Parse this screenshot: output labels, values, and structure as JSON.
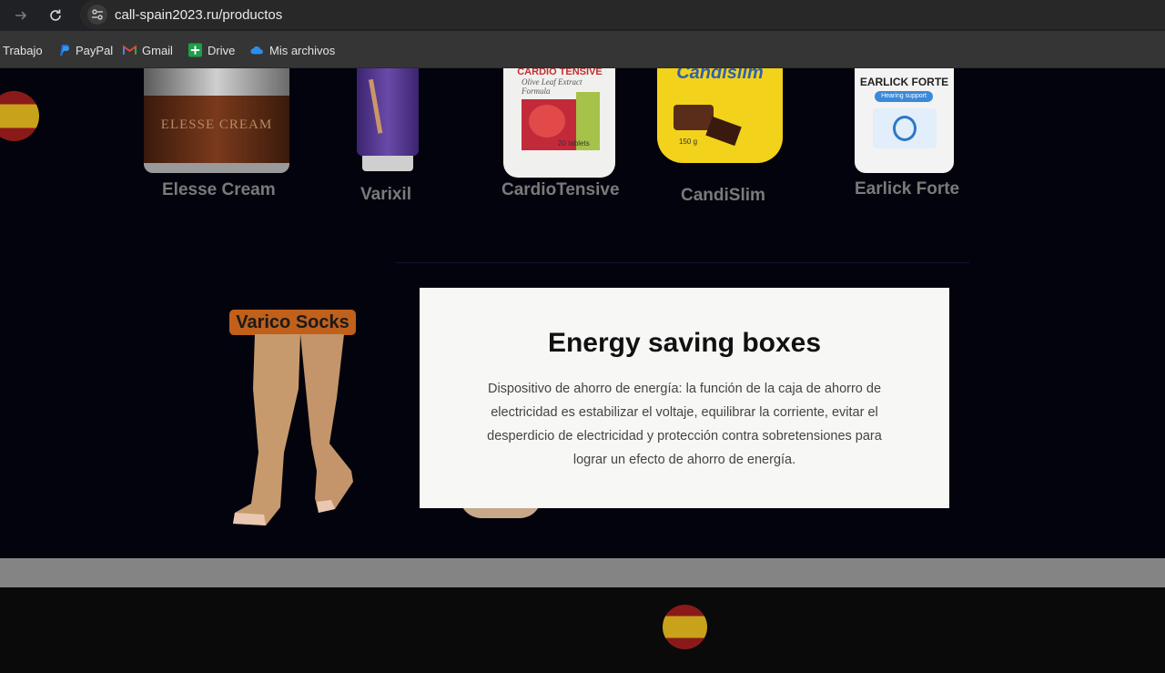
{
  "browser": {
    "url": "call-spain2023.ru/productos",
    "nav_icons": [
      "forward-arrow-icon",
      "reload-icon"
    ],
    "bookmarks": [
      {
        "label": "Trabajo",
        "icon": "folder-icon"
      },
      {
        "label": "PayPal",
        "icon": "paypal-icon"
      },
      {
        "label": "Gmail",
        "icon": "gmail-icon"
      },
      {
        "label": "Drive",
        "icon": "drive-icon"
      },
      {
        "label": "Mis archivos",
        "icon": "onedrive-icon"
      }
    ]
  },
  "products": [
    {
      "name": "Elesse Cream",
      "package_text": "ELESSE CREAM"
    },
    {
      "name": "Varixil"
    },
    {
      "name": "CardioTensive",
      "package_text": "CARDIO TENSIVE",
      "package_subtext": "Olive Leaf Extract Formula",
      "package_count": "20 tablets"
    },
    {
      "name": "CandiSlim",
      "package_text": "Candislim",
      "package_weight": "150 g"
    },
    {
      "name": "Earlick Forte",
      "package_text": "EARLICK FORTE",
      "package_subtext": "Hearing support"
    }
  ],
  "feature_product": {
    "label": "Varico Socks"
  },
  "modal": {
    "title": "Energy saving boxes",
    "text": "Dispositivo de ahorro de energía: la función de la caja de ahorro de electricidad es estabilizar el voltaje, equilibrar la corriente, evitar el desperdicio de electricidad y protección contra sobretensiones para lograr un efecto de ahorro de energía."
  },
  "colors": {
    "page_bg": "#03030d",
    "modal_bg": "#f7f7f5",
    "label_orange": "#c0601a",
    "flag_red": "#8a1a1a",
    "flag_yellow": "#c8a21a"
  }
}
